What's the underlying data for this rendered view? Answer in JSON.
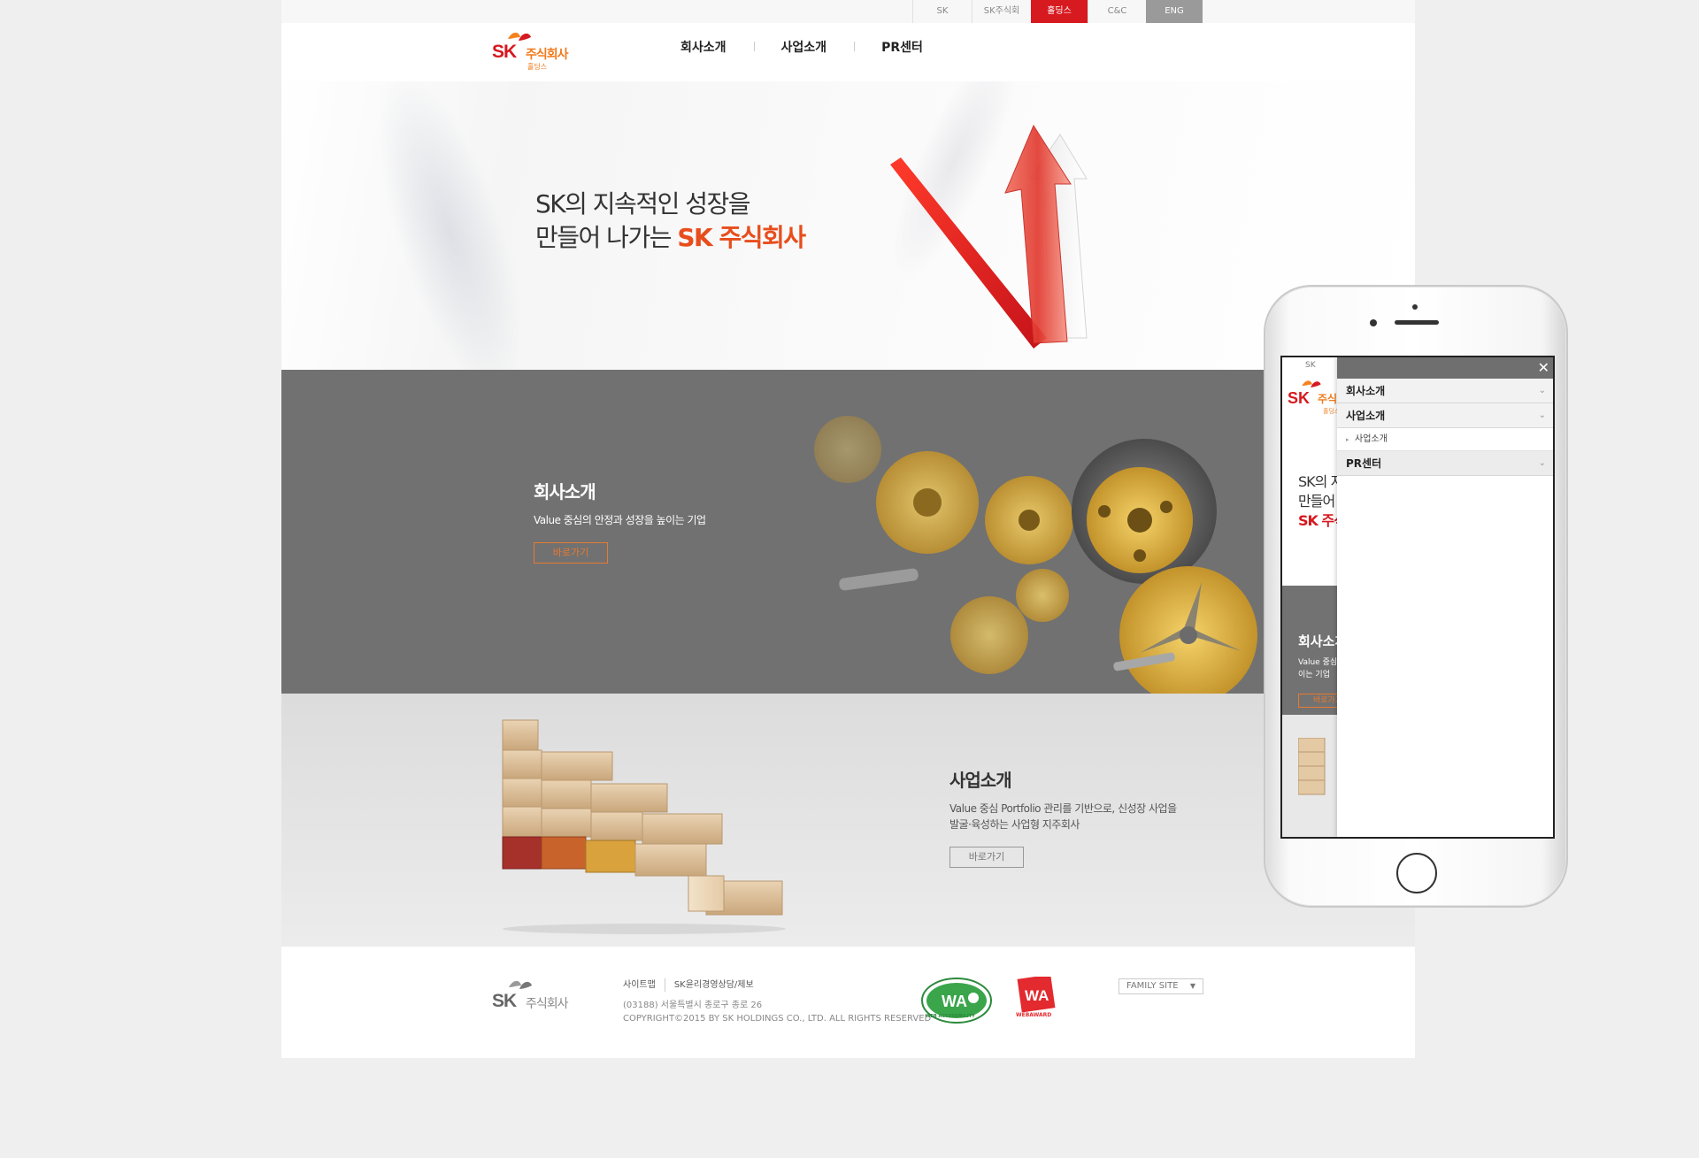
{
  "topbar": {
    "links": [
      "SK",
      "SK주식회사",
      "홀딩스",
      "C&C",
      "ENG"
    ],
    "active_color": "#d71920"
  },
  "logo": {
    "sk": "SK",
    "corp": "주식회사",
    "sub": "홀딩스"
  },
  "nav": [
    "회사소개",
    "사업소개",
    "PR센터"
  ],
  "hero": {
    "line1": "SK의 지속적인 성장을",
    "line2_prefix": "만들어 나가는 ",
    "line2_accent": "SK 주식회사"
  },
  "company_section": {
    "title": "회사소개",
    "desc": "Value 중심의 안정과 성장을 높이는 기업",
    "button": "바로가기"
  },
  "business_section": {
    "title": "사업소개",
    "desc_line1": "Value 중심 Portfolio 관리를 기반으로, 신성장 사업을",
    "desc_line2": "발굴·육성하는 사업형 지주회사",
    "button": "바로가기"
  },
  "footer": {
    "logo_sk": "SK",
    "logo_corp": "주식회사",
    "links": [
      "사이트맵",
      "SK윤리경영상담/제보"
    ],
    "address": "(03188) 서울특별시 종로구 종로 26",
    "copyright": "COPYRIGHT©2015 BY SK HOLDINGS CO., LTD. ALL RIGHTS RESERVED",
    "badge_wa": "WEB ACCESSIBILITY",
    "badge_webaward": "WEBAWARD",
    "family_site": "FAMILY SITE"
  },
  "mobile": {
    "top": "SK",
    "logo_sk": "SK",
    "logo_corp": "주식회사",
    "logo_sub": "홀딩스",
    "hero_line1": "SK의 지속적인 성장을",
    "hero_line2": "만들어 나가는",
    "hero_accent": "SK 주식회사",
    "section_title": "회사소개",
    "section_desc1": "Value 중심의 안정과 성장을 높",
    "section_desc2": "이는 기업",
    "section_button": "바로가기",
    "menu": {
      "close_icon": "close-icon",
      "items": [
        "회사소개",
        "사업소개",
        "PR센터"
      ],
      "subitem": "사업소개"
    }
  }
}
